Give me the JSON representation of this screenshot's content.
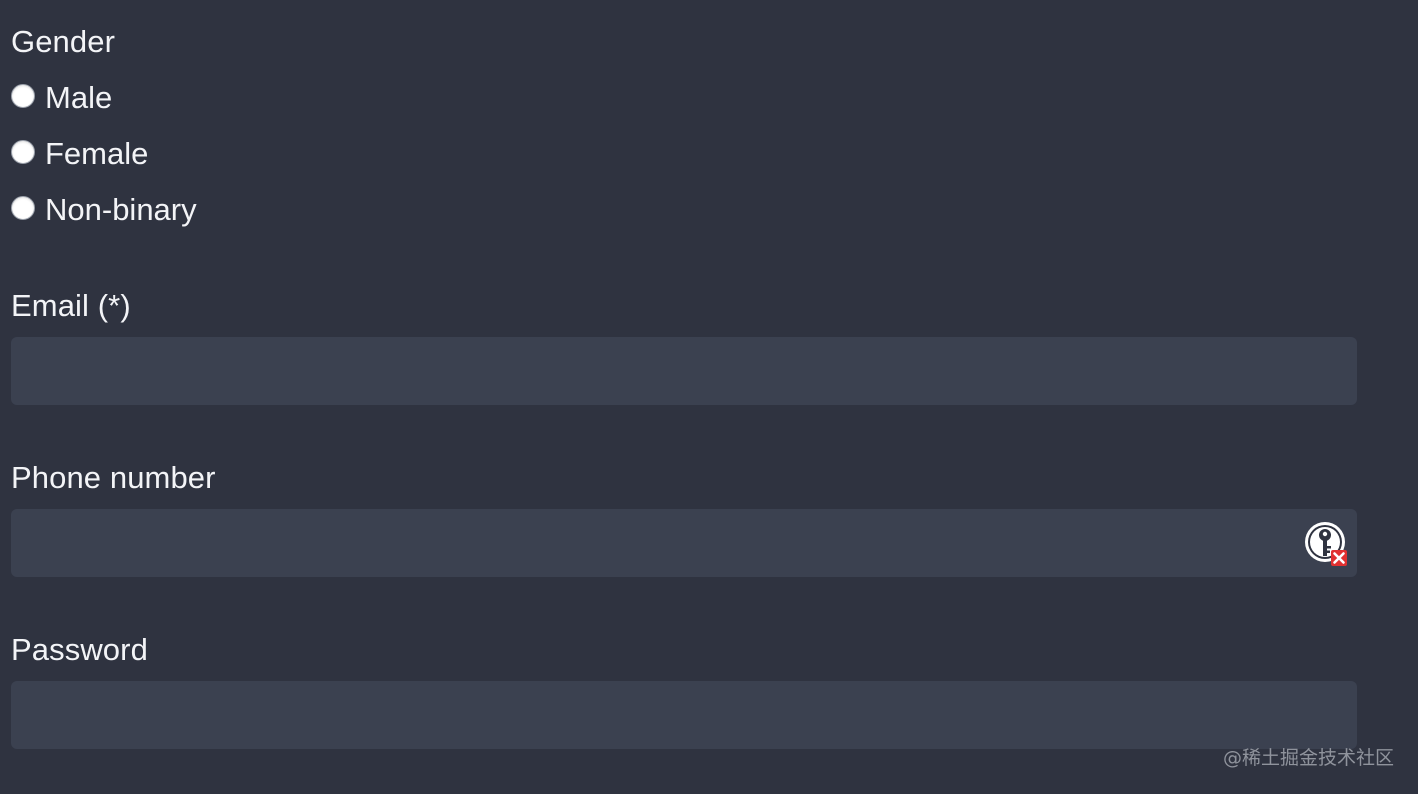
{
  "gender": {
    "label": "Gender",
    "options": [
      {
        "label": "Male"
      },
      {
        "label": "Female"
      },
      {
        "label": "Non-binary"
      }
    ]
  },
  "email": {
    "label": "Email (*)",
    "value": ""
  },
  "phone": {
    "label": "Phone number",
    "value": "",
    "icon": "password-manager-key-icon"
  },
  "password": {
    "label": "Password",
    "value": ""
  },
  "watermark": "@稀土掘金技术社区",
  "colors": {
    "background": "#2f3340",
    "input_background": "#3b4150",
    "text": "#f3f4f7",
    "icon_badge": "#e03131"
  }
}
